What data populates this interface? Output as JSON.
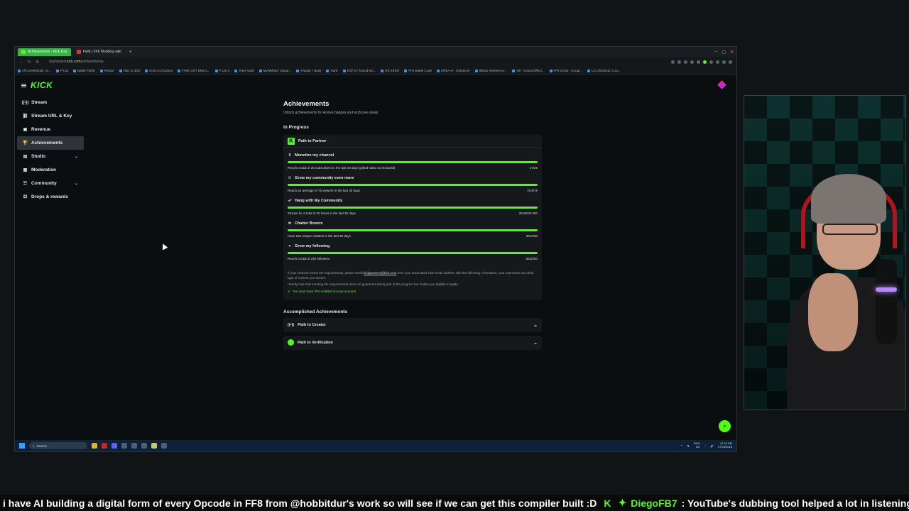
{
  "browser": {
    "tabs": [
      {
        "label": "Achievements - Kick Das"
      },
      {
        "label": "Field | FF8 Modding wiki"
      }
    ],
    "url_prefix": "dashboard.",
    "url_domain": "kick.com",
    "url_path": "/achievements",
    "bookmarks": [
      "All C8 Methods | S...",
      "P List",
      "Battle Fields",
      "Resize",
      "OBJ to 3DS",
      "Echo-3 Dropbox",
      "FF8K OST Ekko's...",
      "P List 2",
      "Pass Vault",
      "MyWelfare, Depar...",
      "Paypal + Bank",
      "AWS",
      "KOFXV Sound Mo...",
      "RE ZERO",
      "FF8 Battle Code",
      "KREA AI - Enhancer",
      "8Bitdo Wireless U...",
      "Vill - Sound Effect...",
      "FF8 Script - Googl...",
      "LG UltraGear Curv..."
    ]
  },
  "sidebar": {
    "logo": "KICK",
    "items": [
      {
        "label": "Stream",
        "icon": "signal-icon",
        "glyph": "((•))"
      },
      {
        "label": "Stream URL & Key",
        "icon": "link-icon",
        "glyph": "⛓"
      },
      {
        "label": "Revenue",
        "icon": "revenue-icon",
        "glyph": "▣"
      },
      {
        "label": "Achievements",
        "icon": "trophy-icon",
        "glyph": "🏆"
      },
      {
        "label": "Studio",
        "icon": "studio-icon",
        "glyph": "▤"
      },
      {
        "label": "Moderation",
        "icon": "shield-icon",
        "glyph": "▦"
      },
      {
        "label": "Community",
        "icon": "community-icon",
        "glyph": "☷"
      },
      {
        "label": "Drops & rewards",
        "icon": "gift-icon",
        "glyph": "⚃"
      }
    ]
  },
  "main": {
    "title": "Achievements",
    "subtitle": "Unlock achievements to receive badges and exclusive deals",
    "in_progress_heading": "In Progress",
    "partner_card": {
      "title": "Path to Partner",
      "goals": [
        {
          "title": "Monetize my channel",
          "desc": "Reach a total of 25 subscribers in the last 30 days (gifted subs not included)",
          "value": "47/25",
          "progress": 1.0
        },
        {
          "title": "Grow my community even more",
          "desc": "Reach an average of 75 viewers in the last 30 days",
          "value": "76.9/75",
          "progress": 1.0
        },
        {
          "title": "Hang with My Community",
          "desc": "Stream for a total of 30 hours in the last 30 days",
          "value": "39.59/30.00h",
          "progress": 1.0
        },
        {
          "title": "Chatter Boxers",
          "desc": "Have 250 unique chatters in the last 30 days",
          "value": "352/250",
          "progress": 1.0
        },
        {
          "title": "Grow my following",
          "desc": "Reach a total of 250 followers",
          "value": "553/250",
          "progress": 1.0
        }
      ],
      "note_part1": "If your channel meets the requirements, please email",
      "note_email": "kickpartners@kick.com",
      "note_part2": "from your associated Kick email address with the following information: your username and what type of content you stream.",
      "note_disclaimer": "*Kindly note that meeting the requirements does not guarantee being part of the program but makes you eligible to apply.",
      "twofa": "You must have 2FA enabled on your account"
    },
    "accomplished_heading": "Accomplished Achievements",
    "accomplished": [
      {
        "title": "Path to Creator"
      },
      {
        "title": "Path to Verification"
      }
    ]
  },
  "taskbar": {
    "search_placeholder": "Search",
    "lang": "ENG",
    "region": "UK",
    "time": "12:34 PM",
    "date": "27/03/2026"
  },
  "ticker": {
    "message": "i have AI building a digital form of every Opcode in FF8 from @hobbitdur's work so will see if we can get this compiler built :D",
    "user": "DiegoFB7",
    "user_message": ": YouTube's dubbing tool helped a lot in listening"
  },
  "colors": {
    "accent": "#53fc18",
    "background": "#0b0e10",
    "card": "#15191c"
  }
}
